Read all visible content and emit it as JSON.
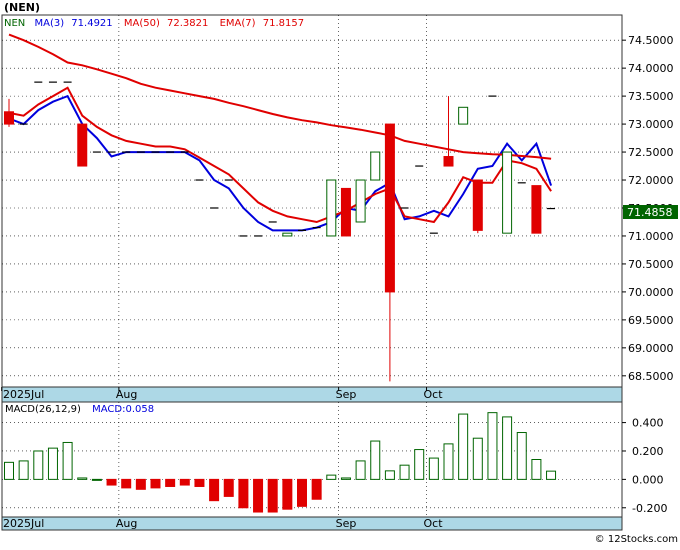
{
  "header": {
    "symbol": "(NEN)",
    "ma3_label": "MA(3)",
    "ma3_value": "71.4921",
    "ma50_label": "MA(50)",
    "ma50_value": "72.3821",
    "ema7_label": "EMA(7)",
    "ema7_value": "71.8157"
  },
  "last_price_tag": "71.4858",
  "macd_header": {
    "label": "MACD(26,12,9)",
    "value_label": "MACD:0.058"
  },
  "watermark": "© 12Stocks.com",
  "colors": {
    "up": "#006400",
    "down": "#e00000",
    "ma3": "#0000dd",
    "ma50": "#e00000",
    "ema7": "#e00000",
    "axis_bar": "#add8e6",
    "last_tag_bg": "#006400"
  },
  "chart_data": [
    {
      "type": "candlestick",
      "ylim": [
        68.3,
        74.95
      ],
      "x_month_labels": [
        {
          "index": 0,
          "label": "2025Jul"
        },
        {
          "index": 8,
          "label": "Aug"
        },
        {
          "index": 23,
          "label": "Sep"
        },
        {
          "index": 29,
          "label": "Oct"
        }
      ],
      "yticks": [
        "74.5000",
        "74.0000",
        "73.5000",
        "73.0000",
        "72.5000",
        "72.0000",
        "71.5000",
        "71.0000",
        "70.5000",
        "70.0000",
        "69.5000",
        "69.0000",
        "68.5000"
      ],
      "candles": [
        {
          "o": 73.22,
          "h": 73.45,
          "l": 72.95,
          "c": 73.0
        },
        {
          "o": 73.0,
          "h": 73.0,
          "l": 73.0,
          "c": 73.0
        },
        {
          "o": 73.75,
          "h": 73.75,
          "l": 73.75,
          "c": 73.75
        },
        {
          "o": 73.75,
          "h": 73.75,
          "l": 73.75,
          "c": 73.75
        },
        {
          "o": 73.75,
          "h": 73.75,
          "l": 73.75,
          "c": 73.75
        },
        {
          "o": 73.0,
          "h": 73.0,
          "l": 72.25,
          "c": 72.25
        },
        {
          "o": 72.5,
          "h": 72.5,
          "l": 72.5,
          "c": 72.5
        },
        {
          "o": 72.5,
          "h": 72.5,
          "l": 72.5,
          "c": 72.5
        },
        {
          "o": 72.5,
          "h": 72.5,
          "l": 72.5,
          "c": 72.5
        },
        {
          "o": 72.5,
          "h": 72.5,
          "l": 72.5,
          "c": 72.5
        },
        {
          "o": 72.5,
          "h": 72.5,
          "l": 72.5,
          "c": 72.5
        },
        {
          "o": 72.5,
          "h": 72.5,
          "l": 72.5,
          "c": 72.5
        },
        {
          "o": 72.5,
          "h": 72.5,
          "l": 72.5,
          "c": 72.5
        },
        {
          "o": 72.0,
          "h": 72.0,
          "l": 72.0,
          "c": 72.0
        },
        {
          "o": 71.5,
          "h": 71.5,
          "l": 71.5,
          "c": 71.5
        },
        {
          "o": 72.0,
          "h": 72.0,
          "l": 72.0,
          "c": 72.0
        },
        {
          "o": 71.0,
          "h": 71.0,
          "l": 71.0,
          "c": 71.0
        },
        {
          "o": 71.0,
          "h": 71.0,
          "l": 71.0,
          "c": 71.0
        },
        {
          "o": 71.25,
          "h": 71.25,
          "l": 71.25,
          "c": 71.25
        },
        {
          "o": 71.0,
          "h": 71.05,
          "l": 71.0,
          "c": 71.05
        },
        {
          "o": 71.1,
          "h": 71.1,
          "l": 71.1,
          "c": 71.1
        },
        {
          "o": 71.15,
          "h": 71.15,
          "l": 71.15,
          "c": 71.15
        },
        {
          "o": 71.0,
          "h": 72.0,
          "l": 71.0,
          "c": 72.0
        },
        {
          "o": 71.85,
          "h": 71.85,
          "l": 71.0,
          "c": 71.0
        },
        {
          "o": 71.25,
          "h": 72.0,
          "l": 71.25,
          "c": 72.0
        },
        {
          "o": 72.0,
          "h": 72.5,
          "l": 72.0,
          "c": 72.5
        },
        {
          "o": 73.0,
          "h": 73.0,
          "l": 68.4,
          "c": 70.0
        },
        {
          "o": 71.5,
          "h": 71.5,
          "l": 71.5,
          "c": 71.5
        },
        {
          "o": 72.25,
          "h": 72.25,
          "l": 72.25,
          "c": 72.25
        },
        {
          "o": 71.05,
          "h": 71.05,
          "l": 71.05,
          "c": 71.05
        },
        {
          "o": 72.42,
          "h": 73.5,
          "l": 72.25,
          "c": 72.25
        },
        {
          "o": 73.0,
          "h": 73.3,
          "l": 73.0,
          "c": 73.3
        },
        {
          "o": 72.0,
          "h": 72.0,
          "l": 71.05,
          "c": 71.1
        },
        {
          "o": 73.5,
          "h": 73.5,
          "l": 73.5,
          "c": 73.5
        },
        {
          "o": 71.05,
          "h": 72.5,
          "l": 71.05,
          "c": 72.5
        },
        {
          "o": 71.95,
          "h": 71.95,
          "l": 71.95,
          "c": 71.95
        },
        {
          "o": 71.9,
          "h": 71.9,
          "l": 71.05,
          "c": 71.05
        },
        {
          "o": 71.49,
          "h": 71.49,
          "l": 71.49,
          "c": 71.49
        }
      ],
      "series": [
        {
          "name": "MA(3)",
          "key": "ma3",
          "values": [
            73.1,
            73.0,
            73.25,
            73.4,
            73.5,
            73.0,
            72.75,
            72.42,
            72.5,
            72.5,
            72.5,
            72.5,
            72.5,
            72.35,
            72.0,
            71.85,
            71.5,
            71.25,
            71.1,
            71.1,
            71.1,
            71.15,
            71.25,
            71.5,
            71.45,
            71.8,
            71.95,
            71.3,
            71.35,
            71.45,
            71.35,
            71.75,
            72.2,
            72.25,
            72.65,
            72.35,
            72.65,
            71.9
          ]
        },
        {
          "name": "EMA(7)",
          "key": "ema7",
          "values": [
            73.2,
            73.15,
            73.35,
            73.5,
            73.65,
            73.15,
            72.95,
            72.8,
            72.7,
            72.65,
            72.6,
            72.6,
            72.55,
            72.4,
            72.25,
            72.1,
            71.85,
            71.6,
            71.45,
            71.35,
            71.3,
            71.25,
            71.35,
            71.45,
            71.6,
            71.75,
            71.85,
            71.35,
            71.3,
            71.25,
            71.6,
            72.05,
            71.95,
            71.95,
            72.35,
            72.3,
            72.2,
            71.8
          ]
        },
        {
          "name": "MA(50)",
          "key": "ma50",
          "values": [
            74.6,
            74.5,
            74.38,
            74.25,
            74.1,
            74.05,
            73.98,
            73.9,
            73.82,
            73.72,
            73.65,
            73.6,
            73.55,
            73.5,
            73.45,
            73.38,
            73.32,
            73.25,
            73.18,
            73.12,
            73.07,
            73.03,
            72.98,
            72.94,
            72.9,
            72.85,
            72.8,
            72.7,
            72.65,
            72.6,
            72.55,
            72.5,
            72.48,
            72.46,
            72.45,
            72.43,
            72.41,
            72.38
          ]
        }
      ]
    },
    {
      "type": "bar",
      "name": "MACD(26,12,9)",
      "ylim": [
        -0.265,
        0.545
      ],
      "yticks": [
        "0.400",
        "0.200",
        "0.000",
        "-0.200"
      ],
      "values": [
        0.12,
        0.13,
        0.2,
        0.22,
        0.26,
        0.01,
        0.0,
        -0.04,
        -0.06,
        -0.07,
        -0.06,
        -0.05,
        -0.04,
        -0.05,
        -0.15,
        -0.12,
        -0.2,
        -0.23,
        -0.23,
        -0.21,
        -0.19,
        -0.14,
        0.03,
        0.01,
        0.13,
        0.27,
        0.06,
        0.1,
        0.21,
        0.15,
        0.25,
        0.46,
        0.29,
        0.47,
        0.44,
        0.33,
        0.14,
        0.058
      ]
    }
  ]
}
